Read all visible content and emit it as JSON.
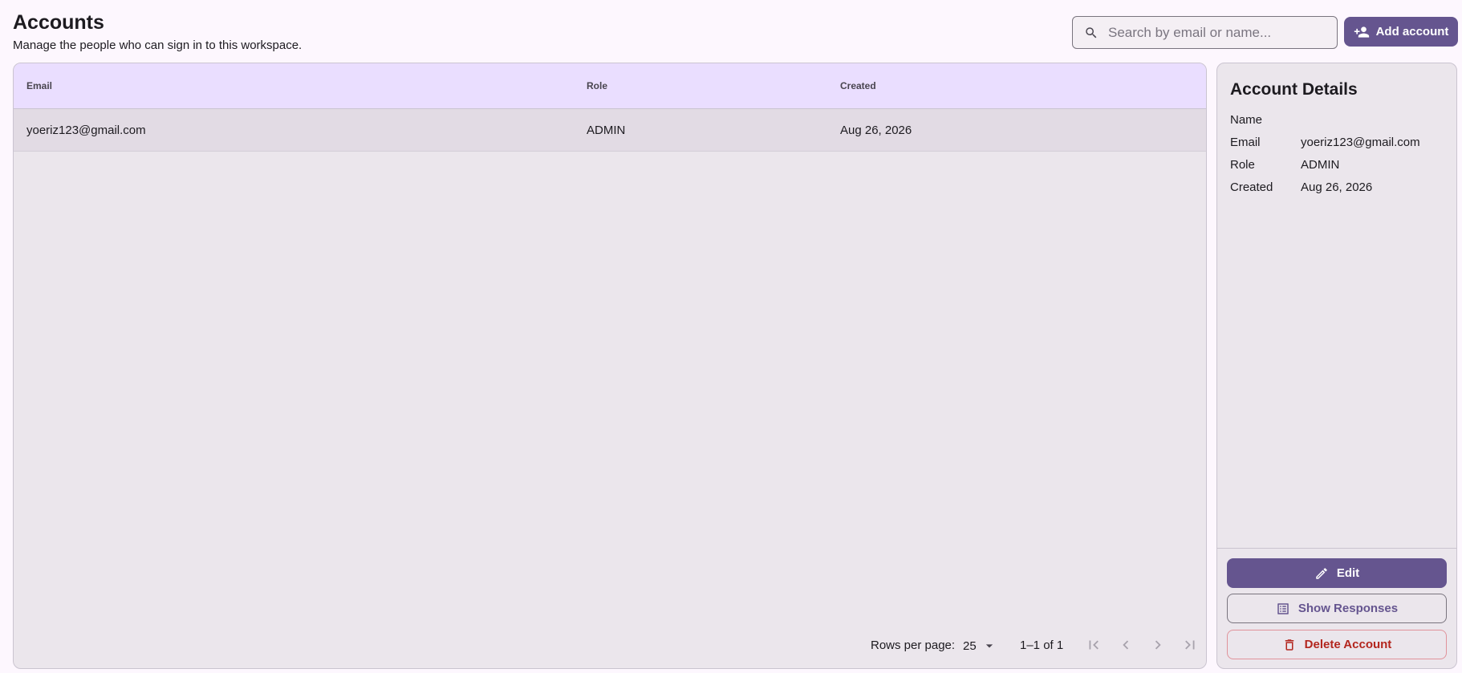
{
  "header": {
    "title": "Accounts",
    "subtitle": "Manage the people who can sign in to this workspace.",
    "search_placeholder": "Search by email or name...",
    "add_button_label": "Add account"
  },
  "table": {
    "columns": [
      "Email",
      "Role",
      "Created"
    ],
    "rows": [
      {
        "email": "yoeriz123@gmail.com",
        "role": "ADMIN",
        "created": "Aug 26, 2026"
      }
    ],
    "pagination": {
      "rows_per_page_label": "Rows per page:",
      "rows_per_page": "25",
      "range": "1–1 of 1"
    }
  },
  "details": {
    "title": "Account Details",
    "fields": [
      {
        "label": "Name",
        "value": ""
      },
      {
        "label": "Email",
        "value": "yoeriz123@gmail.com"
      },
      {
        "label": "Role",
        "value": "ADMIN"
      },
      {
        "label": "Created",
        "value": "Aug 26, 2026"
      }
    ],
    "edit_label": "Edit",
    "responses_label": "Show Responses",
    "delete_label": "Delete Account"
  },
  "colors": {
    "primary": "#65558f",
    "header_bg": "#eadeff",
    "danger": "#b3261e",
    "page_bg": "#fdf7fe"
  }
}
